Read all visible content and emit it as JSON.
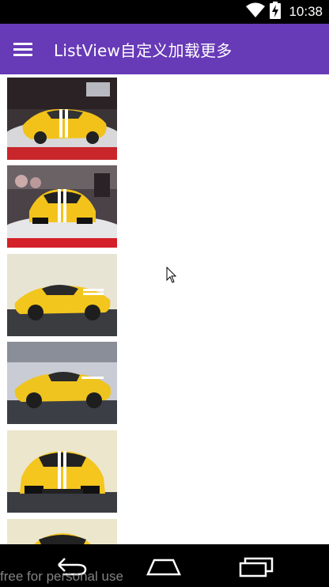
{
  "status_bar": {
    "time": "10:38",
    "icons": [
      "wifi-icon",
      "battery-charging-icon"
    ]
  },
  "app_bar": {
    "title": "ListView自定义加载更多",
    "nav_icon": "hamburger-menu-icon",
    "color": "#673ab7"
  },
  "list": {
    "items": [
      {
        "image": "yellow-ferrari-turntable-photo"
      },
      {
        "image": "yellow-ferrari-front-show-photo"
      },
      {
        "image": "yellow-ferrari-side-photo"
      },
      {
        "image": "yellow-ferrari-rear-side-photo"
      },
      {
        "image": "yellow-ferrari-front-photo"
      },
      {
        "image": "yellow-ferrari-partial-photo"
      }
    ]
  },
  "nav_bar": {
    "icons": [
      "back-icon",
      "home-icon",
      "recents-icon"
    ]
  },
  "watermark": "free for personal use"
}
